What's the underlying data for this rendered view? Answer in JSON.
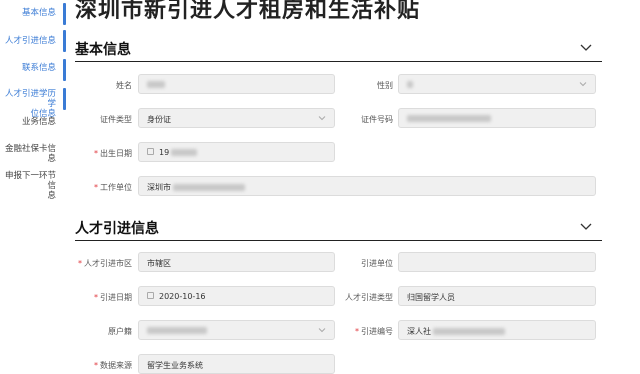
{
  "page_title": "深圳市新引进人才租房和生活补贴",
  "sidebar": {
    "items": [
      {
        "label": "基本信息"
      },
      {
        "label": "人才引进信息"
      },
      {
        "label": "联系信息"
      },
      {
        "label_line1": "人才引进学历学",
        "label_line2": "位信息"
      },
      {
        "label": "业务信息"
      },
      {
        "label": "金融社保卡信息"
      },
      {
        "label_line1": "申报下一环节信",
        "label_line2": "息"
      }
    ]
  },
  "basic_info": {
    "title": "基本信息",
    "name_label": "姓名",
    "gender_label": "性别",
    "id_type_label": "证件类型",
    "id_type_value": "身份证",
    "id_number_label": "证件号码",
    "birth_date_label": "出生日期",
    "birth_date_value": "19",
    "workplace_label": "工作单位",
    "workplace_value": "深圳市"
  },
  "talent_info": {
    "title": "人才引进信息",
    "city_area_label": "人才引进市区",
    "city_area_value": "市辖区",
    "unit_label": "引进单位",
    "date_label": "引进日期",
    "date_value": "2020-10-16",
    "type_label": "人才引进类型",
    "type_value": "归国留学人员",
    "hukou_label": "原户籍",
    "number_label": "引进编号",
    "number_value": "深人社",
    "source_label": "数据来源",
    "source_value": "留学生业务系统"
  }
}
